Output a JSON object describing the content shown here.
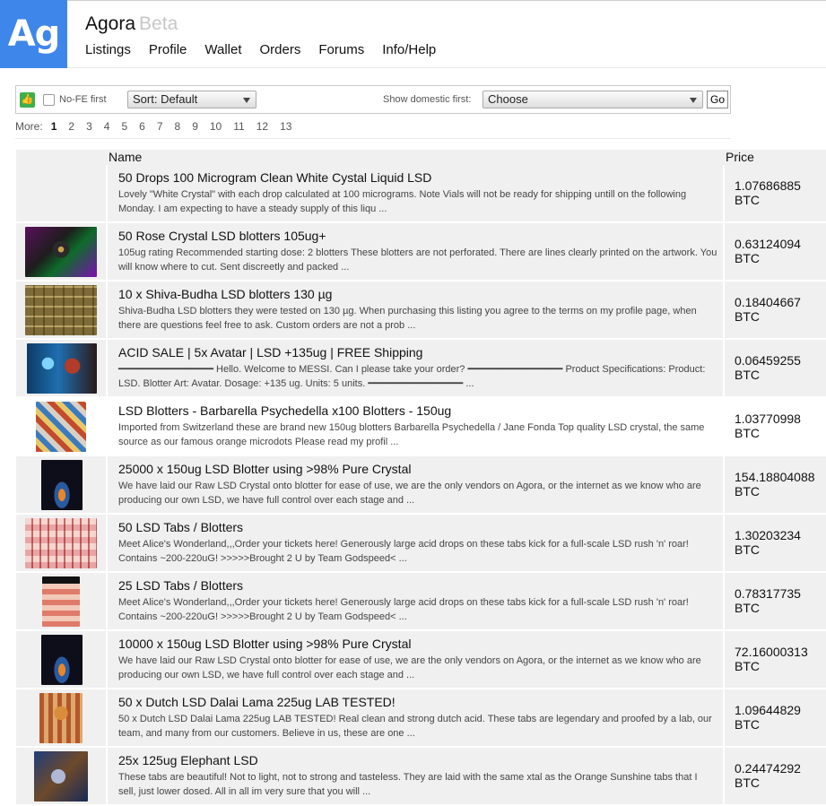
{
  "logo_text": "Ag",
  "brand": {
    "name": "Agora",
    "tag": "Beta"
  },
  "nav": [
    "Listings",
    "Profile",
    "Wallet",
    "Orders",
    "Forums",
    "Info/Help"
  ],
  "filters": {
    "nofe_label": "No-FE first",
    "sort_value": "Sort: Default",
    "domestic_label": "Show domestic first:",
    "domestic_value": "Choose",
    "go_label": "Go"
  },
  "pager": {
    "more_label": "More:",
    "pages": [
      "1",
      "2",
      "3",
      "4",
      "5",
      "6",
      "7",
      "8",
      "9",
      "10",
      "11",
      "12",
      "13"
    ],
    "current": "1"
  },
  "table": {
    "col_name": "Name",
    "col_price": "Price",
    "currency": "BTC",
    "rows": [
      {
        "title": "50 Drops 100 Microgram Clean White Cystal Liquid LSD",
        "desc": "Lovely \"White Crystal\" with each drop calculated at 100 micrograms. Note Vials will not be ready for shipping untill on the following Monday. I am expecting to have a steady supply of this liqu ...",
        "price": "1.07686885",
        "thumb": "none"
      },
      {
        "title": "50 Rose Crystal LSD blotters 105ug+",
        "desc": "105ug rating Recommended starting dose: 2 blotters These blotters are not perforated. There are lines clearly printed on the artwork. You will know where to cut. Sent discreetly and packed ...",
        "price": "0.63124094",
        "thumb": "rose"
      },
      {
        "title": "10 x Shiva-Budha LSD blotters 130 µg",
        "desc": "Shiva-Budha LSD blotters they were tested on 130 µg. When purchasing this listing you agree to the terms on my profile page, when there are questions feel free to ask. Custom orders are not a prob ...",
        "price": "0.18404667",
        "thumb": "shiva"
      },
      {
        "title": "ACID SALE | 5x Avatar | LSD +135ug | FREE Shipping",
        "desc": "━━━━━━━━━━━━━━━━ Hello. Welcome to MESSI. Can I please take your order? ━━━━━━━━━━━━━━━━ Product Specifications: Product: LSD. Blotter Art: Avatar. Dosage: +135 ug. Units: 5 units. ━━━━━━━━━━━━━━━━ ...",
        "price": "0.06459255",
        "thumb": "avatar"
      },
      {
        "title": "LSD Blotters - Barbarella Psychedella x100 Blotters - 150ug",
        "desc": "Imported from Switzerland these are brand new 150ug blotters Barbarella Psychedella / Jane Fonda Top quality LSD crystal, the same source as our famous orange microdots Please read my profil ...",
        "price": "1.03770998",
        "thumb": "barbarella"
      },
      {
        "title": "25000 x 150ug LSD Blotter using >98% Pure Crystal",
        "desc": "We have laid our Raw LSD Crystal onto blotter for ease of use, we are the only vendors on Agora, or the internet as we know who are producing our own LSD, we have full control over each stage and ...",
        "price": "154.18804088",
        "thumb": "dark"
      },
      {
        "title": "50 LSD Tabs / Blotters",
        "desc": "Meet Alice's Wonderland,,,Order your tickets here! Generously large acid drops on these tabs kick for a full-scale LSD rush 'n' roar! Contains ~200-220uG! >>>>>Brought 2 U by Team Godspeed< ...",
        "price": "1.30203234",
        "thumb": "alice"
      },
      {
        "title": "25 LSD Tabs / Blotters",
        "desc": "Meet Alice's Wonderland,,,Order your tickets here! Generously large acid drops on these tabs kick for a full-scale LSD rush 'n' roar! Contains ~200-220uG! >>>>>Brought 2 U by Team Godspeed< ...",
        "price": "0.78317735",
        "thumb": "alice2"
      },
      {
        "title": "10000 x 150ug LSD Blotter using >98% Pure Crystal",
        "desc": "We have laid our Raw LSD Crystal onto blotter for ease of use, we are the only vendors on Agora, or the internet as we know who are producing our own LSD, we have full control over each stage and ...",
        "price": "72.16000313",
        "thumb": "dark"
      },
      {
        "title": "50 x Dutch LSD Dalai Lama 225ug LAB TESTED!",
        "desc": "50 x Dutch LSD Dalai Lama 225ug LAB TESTED! Real clean and strong dutch acid. These tabs are legendary and proofed by a lab, our team, and many from our customers. Believe in us, these are one ...",
        "price": "1.09644829",
        "thumb": "dalai"
      },
      {
        "title": "25x 125ug Elephant LSD",
        "desc": "These tabs are beautiful! Not to light, not to strong and tasteless. They are laid with the same xtal as the Orange Sunshine tabs that I sell, just lower dosed. All in all im very sure that you will ...",
        "price": "0.24474292",
        "thumb": "elephant"
      }
    ]
  }
}
